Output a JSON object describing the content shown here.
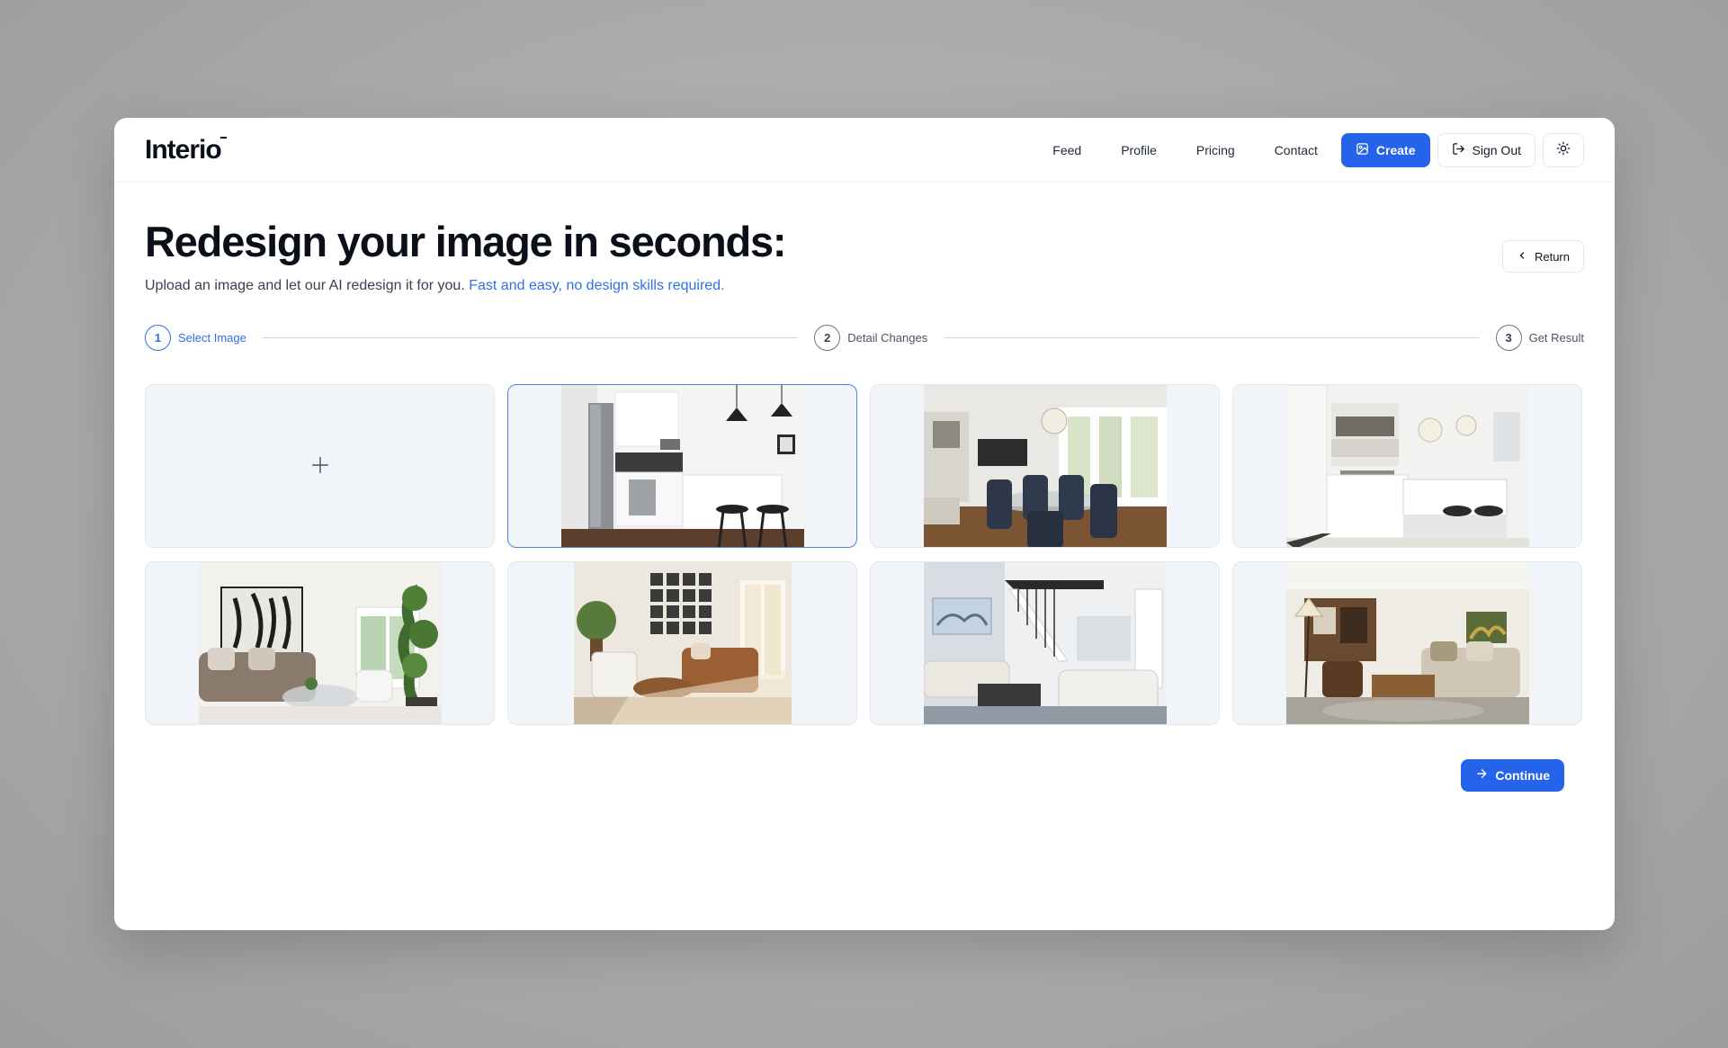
{
  "app": {
    "logo": "Interio"
  },
  "nav": {
    "links": [
      "Feed",
      "Profile",
      "Pricing",
      "Contact"
    ],
    "create_label": "Create",
    "signout_label": "Sign Out",
    "theme_icon": "sun-icon"
  },
  "hero": {
    "title": "Redesign your image in seconds:",
    "subtitle_plain": "Upload an image and let our AI redesign it for you.",
    "subtitle_accent": "Fast and easy, no design skills required.",
    "return_label": "Return"
  },
  "steps": [
    {
      "number": "1",
      "label": "Select Image",
      "active": true
    },
    {
      "number": "2",
      "label": "Detail Changes",
      "active": false
    },
    {
      "number": "3",
      "label": "Get Result",
      "active": false
    }
  ],
  "gallery": {
    "upload_icon": "plus-icon",
    "selected_index": 1,
    "images": [
      {
        "name": "kitchen-white-bar-stools"
      },
      {
        "name": "dining-room-chandelier"
      },
      {
        "name": "kitchen-island-pendants"
      },
      {
        "name": "living-room-plant-windows"
      },
      {
        "name": "living-room-gallery-wall"
      },
      {
        "name": "living-room-staircase"
      },
      {
        "name": "open-plan-living-room"
      }
    ]
  },
  "actions": {
    "continue_label": "Continue"
  },
  "colors": {
    "accent": "#2563eb",
    "selected_border": "#4b84ec",
    "tile_bg": "#f1f4f8"
  }
}
